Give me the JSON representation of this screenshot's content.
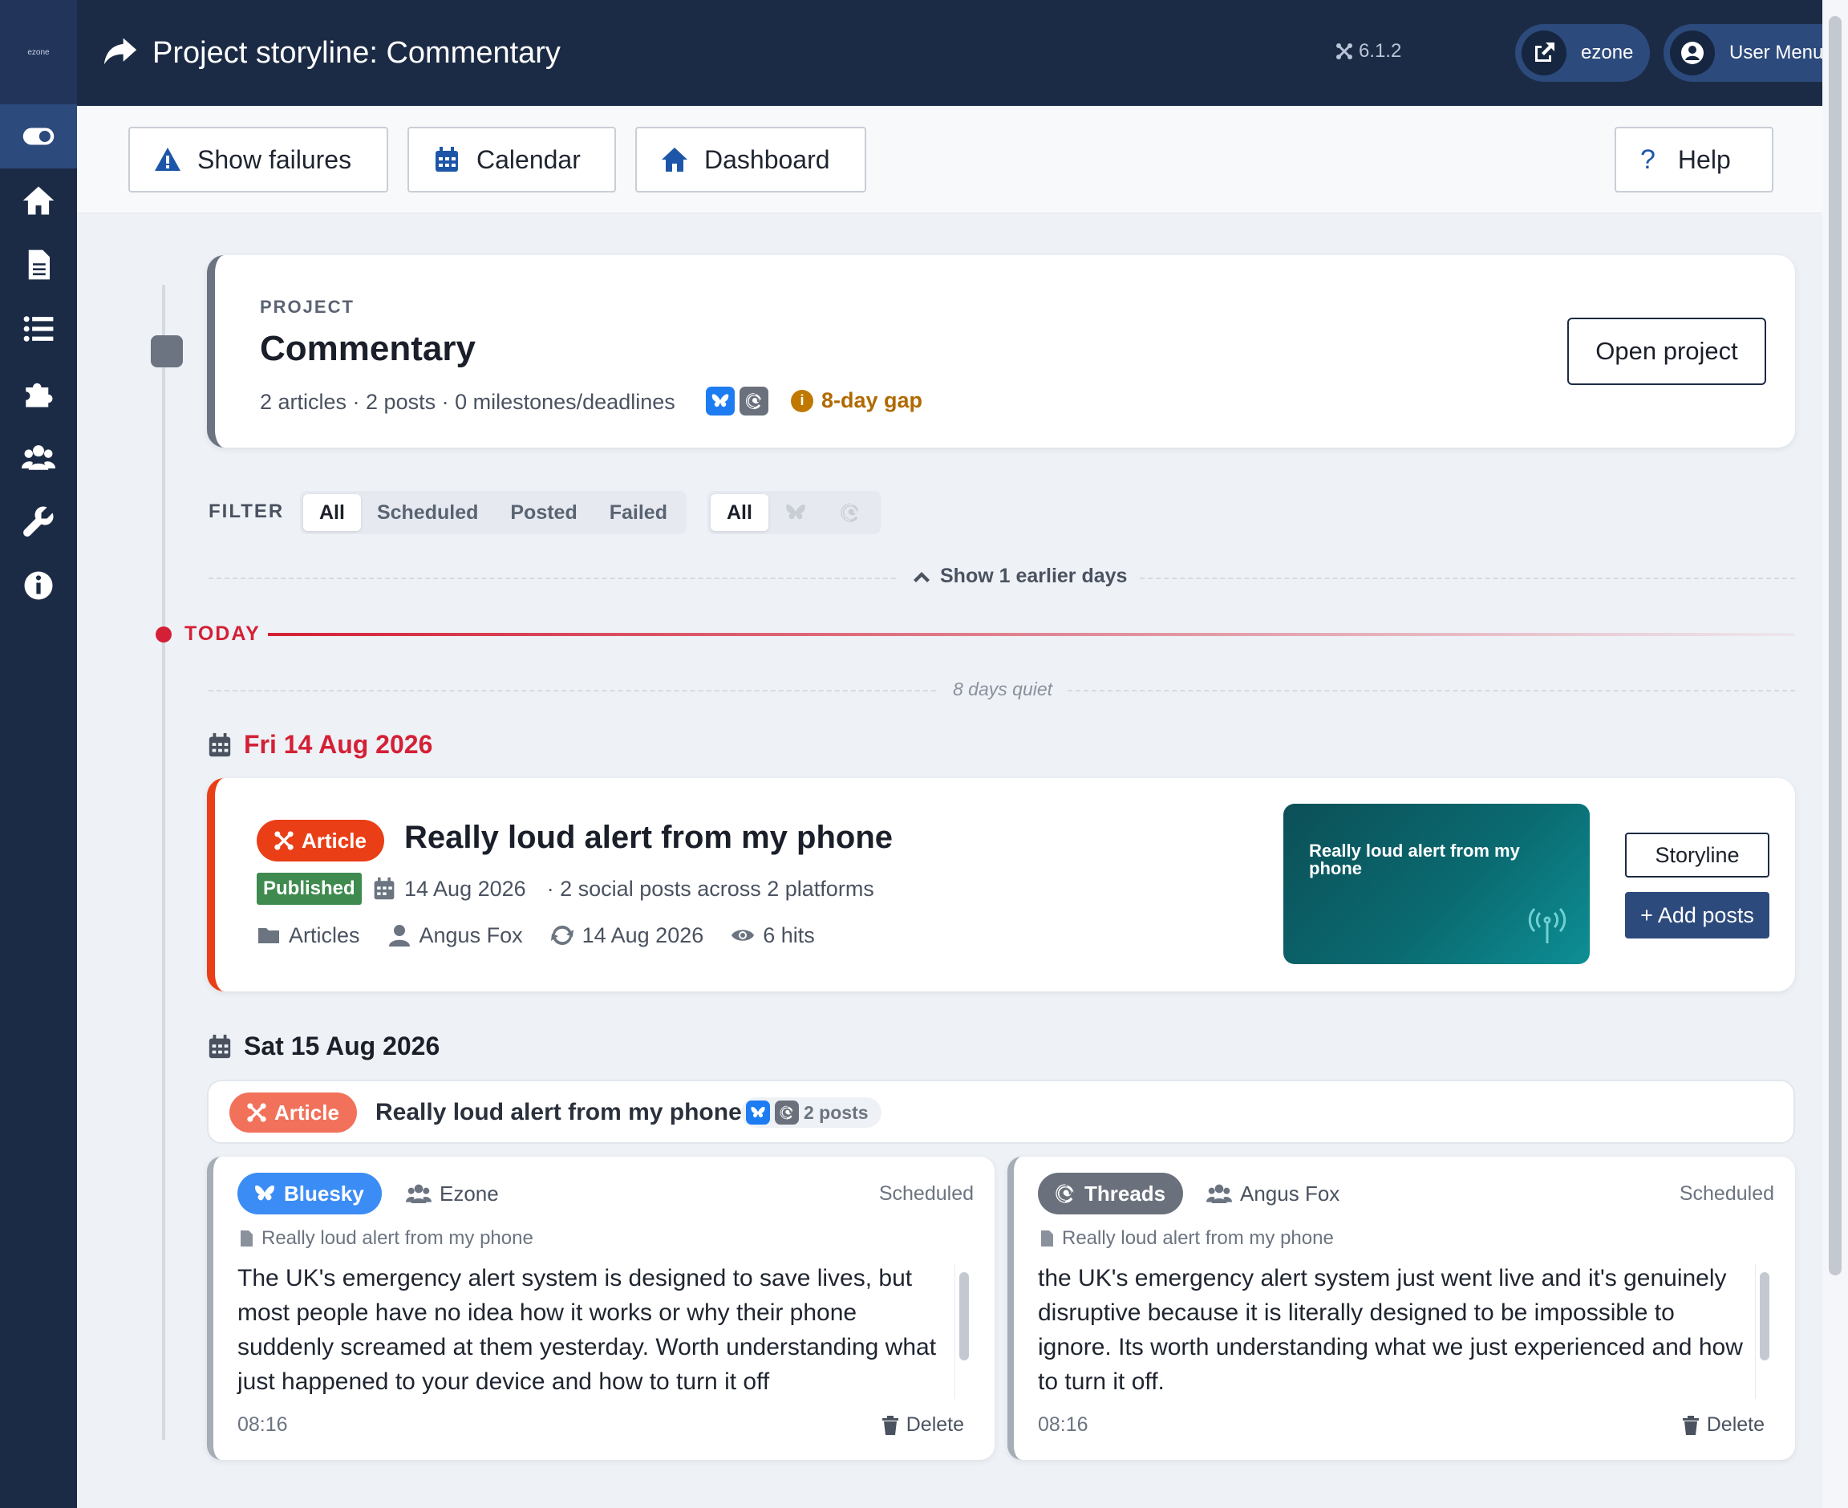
{
  "sidebar": {
    "logo": "ezone",
    "items": [
      {
        "name": "toggle",
        "icon": "toggle-icon"
      },
      {
        "name": "home",
        "icon": "home-icon"
      },
      {
        "name": "articles",
        "icon": "file-icon"
      },
      {
        "name": "list",
        "icon": "list-icon"
      },
      {
        "name": "extensions",
        "icon": "puzzle-icon"
      },
      {
        "name": "users",
        "icon": "users-icon"
      },
      {
        "name": "system",
        "icon": "wrench-icon"
      },
      {
        "name": "info",
        "icon": "info-icon"
      }
    ]
  },
  "header": {
    "title": "Project storyline: Commentary",
    "version": "6.1.2",
    "site_label": "ezone",
    "user_menu_label": "User Menu"
  },
  "toolbar": {
    "show_failures": "Show failures",
    "calendar": "Calendar",
    "dashboard": "Dashboard",
    "help": "Help"
  },
  "project": {
    "kicker": "PROJECT",
    "name": "Commentary",
    "meta": "2 articles · 2 posts · 0 milestones/deadlines",
    "gap": "8-day gap",
    "gap_icon": "i",
    "open_button": "Open project"
  },
  "filter": {
    "label": "FILTER",
    "status_options": [
      "All",
      "Scheduled",
      "Posted",
      "Failed"
    ],
    "status_selected": "All",
    "platform_all": "All"
  },
  "timeline": {
    "show_earlier": "Show 1 earlier days",
    "today_label": "TODAY",
    "quiet_label": "8 days quiet"
  },
  "days": [
    {
      "heading": "Fri 14 Aug 2026",
      "article": {
        "badge": "Article",
        "title": "Really loud alert from my phone",
        "status": "Published",
        "date": "14 Aug 2026",
        "social_summary": "· 2 social posts across 2 platforms",
        "category": "Articles",
        "author": "Angus Fox",
        "modified": "14 Aug 2026",
        "hits": "6 hits",
        "thumbnail_title": "Really loud alert from my phone",
        "storyline_button": "Storyline",
        "add_posts_button": "+ Add posts"
      }
    },
    {
      "heading": "Sat 15 Aug 2026",
      "summary": {
        "badge": "Article",
        "title": "Really loud alert from my phone",
        "posts_count": "2 posts"
      },
      "posts": [
        {
          "platform": "Bluesky",
          "account": "Ezone",
          "status": "Scheduled",
          "source": "Really loud alert from my phone",
          "body": "The UK's emergency alert system is designed to save lives, but most people have no idea how it works or why their phone suddenly screamed at them yesterday. Worth understanding what just happened to your device and how to turn it off",
          "time": "08:16",
          "delete_label": "Delete"
        },
        {
          "platform": "Threads",
          "account": "Angus Fox",
          "status": "Scheduled",
          "source": "Really loud alert from my phone",
          "body": "the UK's emergency alert system just went live and it's genuinely disruptive because it is literally designed to be impossible to ignore. Its worth understanding what we just experienced and how to turn it off.",
          "time": "08:16",
          "delete_label": "Delete"
        }
      ]
    }
  ],
  "colors": {
    "header_bg": "#1c2b45",
    "accent_blue": "#1d56a8",
    "today_red": "#d42036",
    "article_orange": "#ea3e16",
    "published_green": "#3e8a4f",
    "gap_amber": "#b06a00",
    "bluesky": "#1d7cf2",
    "threads": "#6a717c"
  }
}
